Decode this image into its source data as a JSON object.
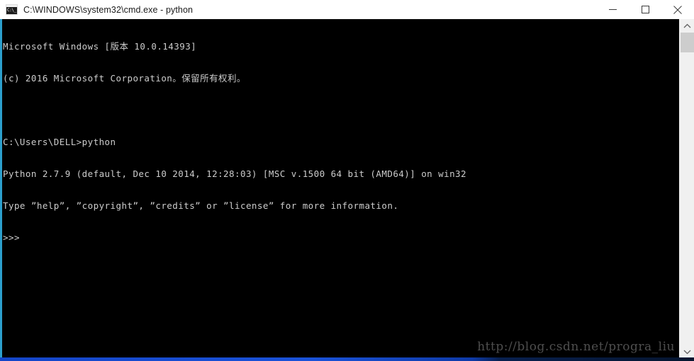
{
  "window": {
    "title": "C:\\WINDOWS\\system32\\cmd.exe - python",
    "icon_name": "cmd-console-icon",
    "icon_text": "C:\\_",
    "controls": {
      "minimize_label": "Minimize",
      "maximize_label": "Maximize",
      "close_label": "Close"
    },
    "titlebar_bg": "#ffffff",
    "titlebar_fg": "#1b1b1b",
    "accent_edge": "#1a97c8"
  },
  "console": {
    "background": "#000000",
    "foreground": "#cccccc",
    "lines": [
      "Microsoft Windows [版本 10.0.14393]",
      "(c) 2016 Microsoft Corporation。保留所有权利。",
      "",
      "C:\\Users\\DELL>python",
      "Python 2.7.9 (default, Dec 10 2014, 12:28:03) [MSC v.1500 64 bit (AMD64)] on win32",
      "Type ”help”, ”copyright”, ”credits” or ”license” for more information.",
      ">>>"
    ],
    "prompt": ">>>",
    "watermark": "http://blog.csdn.net/progra_liu",
    "watermark_color": "#4e4e4e"
  },
  "scrollbar": {
    "up_arrow": "chevron-up",
    "down_arrow": "chevron-down",
    "track_color": "#f0f0f0",
    "thumb_color": "#cdcdcd"
  },
  "desktop": {
    "strip_color": "#1445c8"
  }
}
